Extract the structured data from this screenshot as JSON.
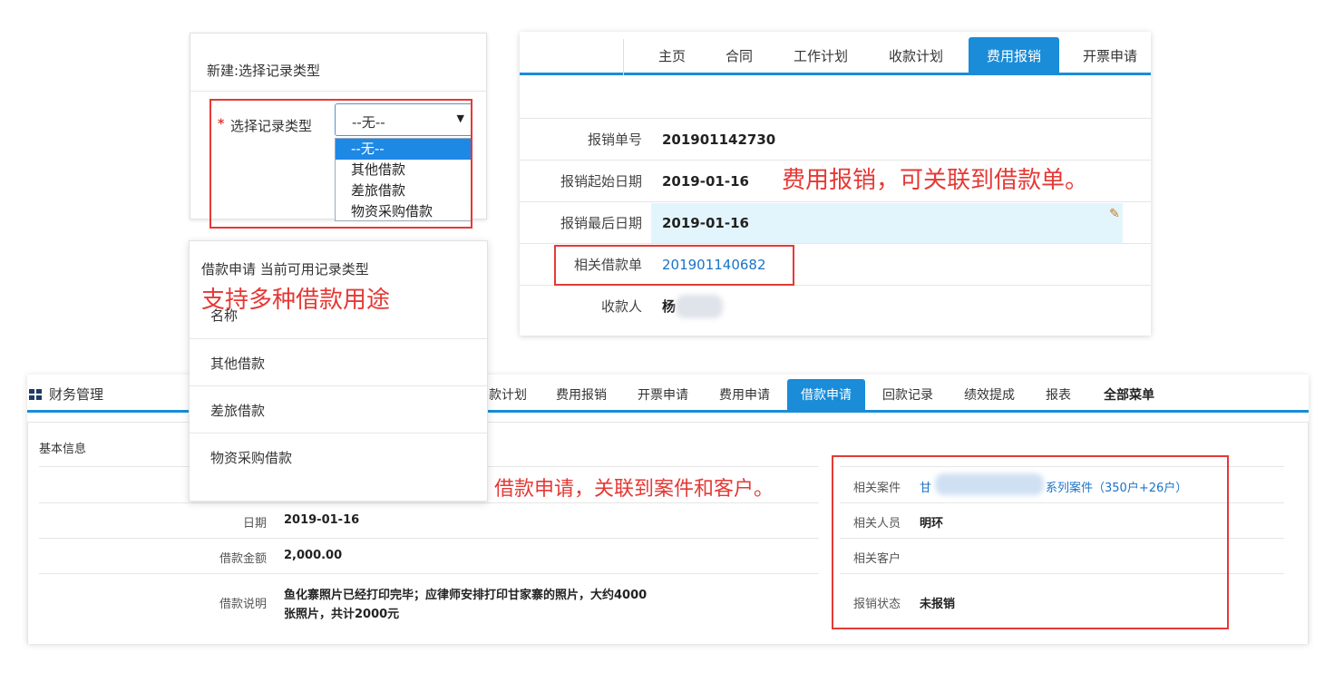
{
  "top_right": {
    "tabs": [
      "主页",
      "合同",
      "工作计划",
      "收款计划",
      "费用报销",
      "开票申请"
    ],
    "active_tab": "费用报销",
    "fields": [
      {
        "label": "报销单号",
        "value": "201901142730"
      },
      {
        "label": "报销起始日期",
        "value": "2019-01-16"
      },
      {
        "label": "报销最后日期",
        "value": "2019-01-16"
      },
      {
        "label": "相关借款单",
        "value": "201901140682"
      },
      {
        "label": "收款人",
        "value": "杨"
      }
    ],
    "annotation": "费用报销，可关联到借款单。"
  },
  "record_type_dialog": {
    "title": "新建:选择记录类型",
    "required_mark": "*",
    "label": "选择记录类型",
    "selected_value": "--无--",
    "options": [
      "--无--",
      "其他借款",
      "差旅借款",
      "物资采购借款"
    ]
  },
  "loan_types_panel": {
    "heading": "借款申请 当前可用记录类型",
    "annotation": "支持多种借款用途",
    "column_header": "名称",
    "items": [
      "其他借款",
      "差旅借款",
      "物资采购借款"
    ]
  },
  "bottom": {
    "brand": "财务管理",
    "tabs": [
      "款计划",
      "费用报销",
      "开票申请",
      "费用申请",
      "借款申请",
      "回款记录",
      "绩效提成",
      "报表",
      "全部菜单"
    ],
    "active_tab": "借款申请",
    "section_title": "基本信息",
    "annotation": "借款申请，关联到案件和客户。",
    "left_fields": [
      {
        "label": "日期",
        "value": "2019-01-16"
      },
      {
        "label": "借款金额",
        "value": "2,000.00"
      },
      {
        "label": "借款说明",
        "value_line1": "鱼化寨照片已经打印完毕；应律师安排打印甘家寨的照片，大约4000",
        "value_line2": "张照片，共计2000元"
      }
    ],
    "right_fields": [
      {
        "label": "相关案件",
        "value_prefix": "甘",
        "value_suffix": "系列案件（350户+26户）"
      },
      {
        "label": "相关人员",
        "value": "明环"
      },
      {
        "label": "相关客户",
        "value": ""
      },
      {
        "label": "报销状态",
        "value": "未报销"
      }
    ]
  },
  "colors": {
    "accent": "#1a8cd8",
    "annotation_red": "#e53935",
    "link": "#1a73c8",
    "highlight": "#e3f5fc"
  }
}
